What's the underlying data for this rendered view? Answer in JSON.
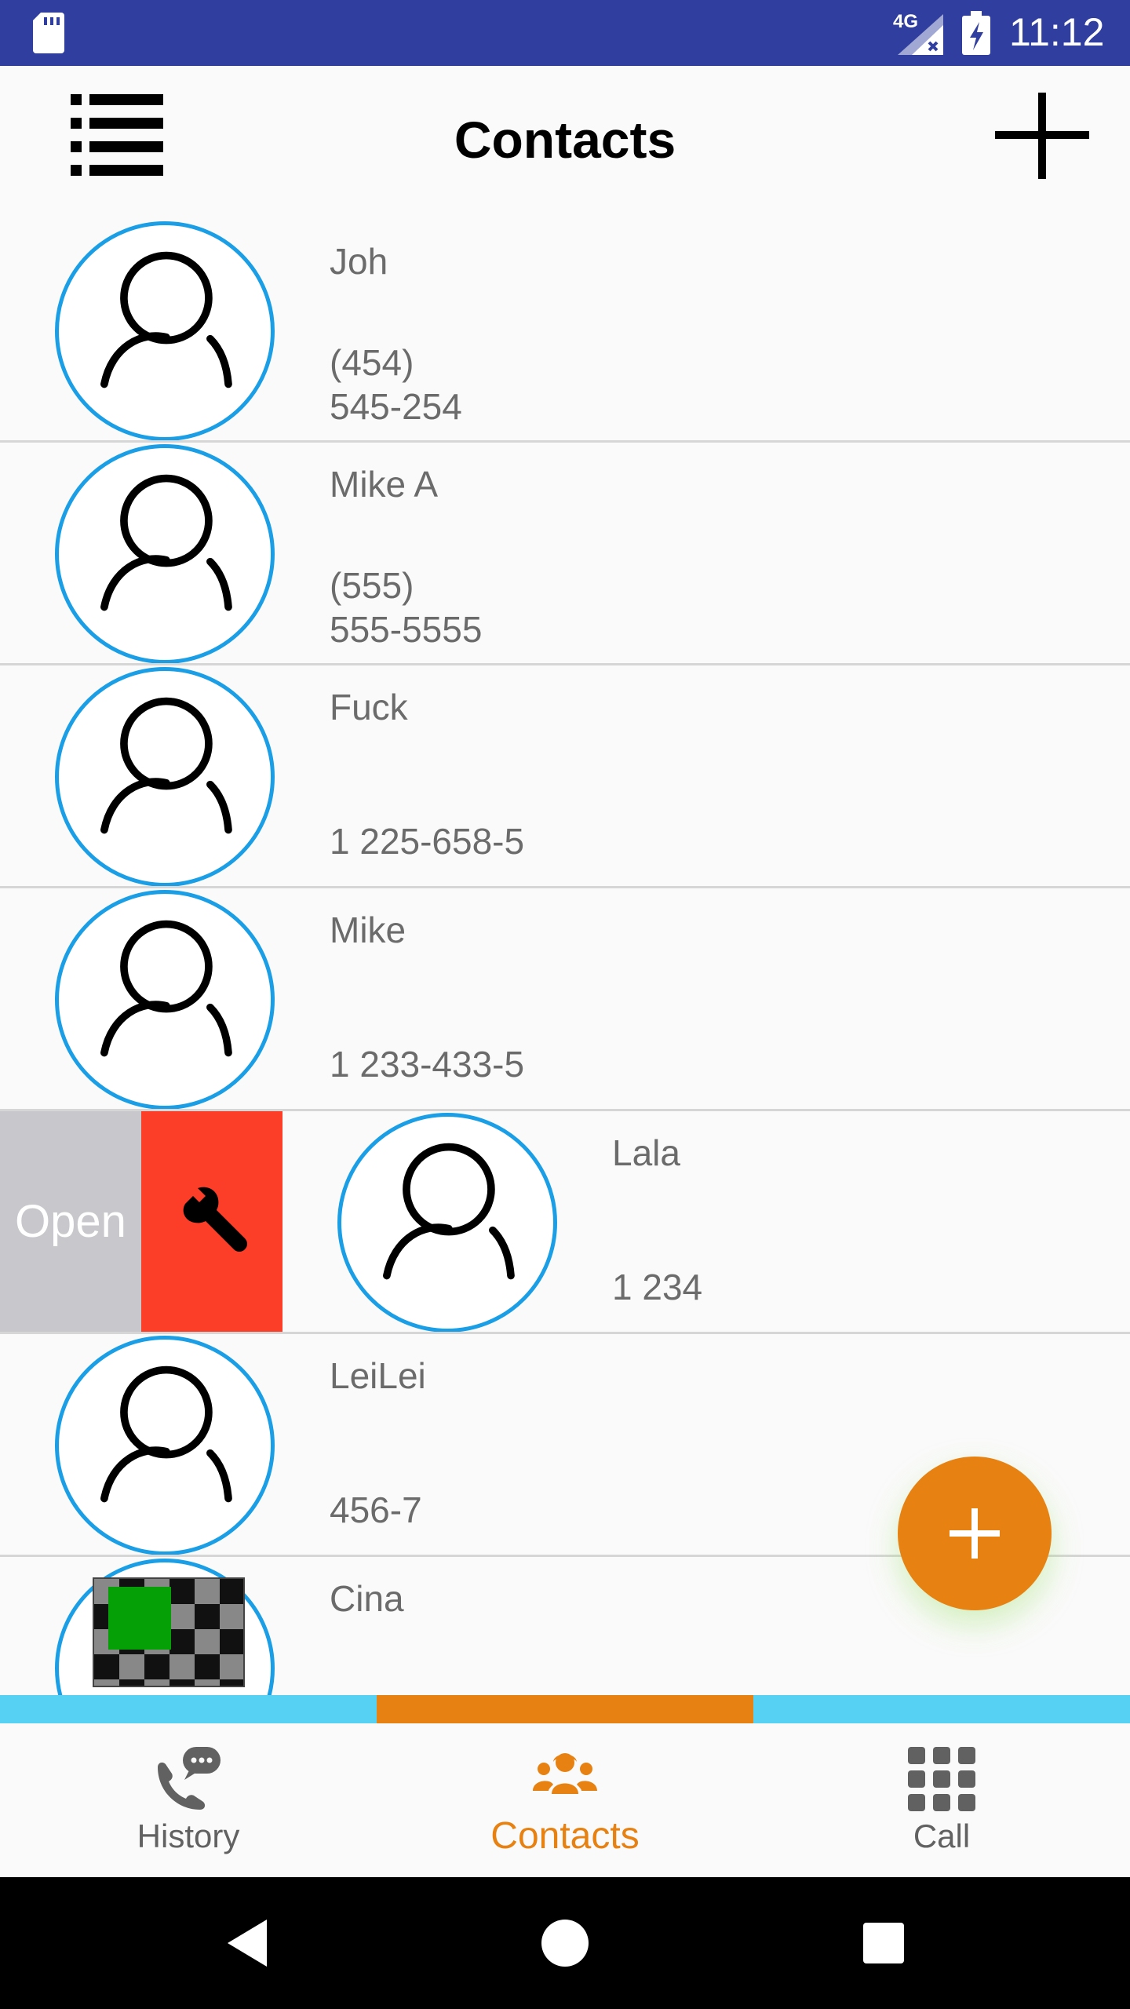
{
  "status_bar": {
    "network_label": "4G",
    "time": "11:12"
  },
  "app_bar": {
    "title": "Contacts",
    "menu_icon": "list-menu-icon",
    "add_icon": "plus-icon"
  },
  "contacts": [
    {
      "name": "Joh",
      "phone": "(454)\n545-254"
    },
    {
      "name": "Mike A",
      "phone": "(555)\n555-5555"
    },
    {
      "name": "Fuck",
      "phone": "1 225-658-5"
    },
    {
      "name": "Mike",
      "phone": "1 233-433-5"
    },
    {
      "name": "Lala",
      "phone": "1 234"
    },
    {
      "name": "LeiLei",
      "phone": "456-7"
    },
    {
      "name": "Cina",
      "phone": ""
    }
  ],
  "swipe_actions": {
    "open_label": "Open",
    "settings_icon": "wrench-icon"
  },
  "fab": {
    "icon": "plus-icon"
  },
  "tabs": [
    {
      "label": "History",
      "icon": "phone-chat-icon",
      "active": false
    },
    {
      "label": "Contacts",
      "icon": "group-icon",
      "active": true
    },
    {
      "label": "Call",
      "icon": "dialpad-icon",
      "active": false
    }
  ],
  "colors": {
    "status_bar": "#303f9f",
    "avatar_ring": "#1a9ee5",
    "accent": "#e78212",
    "tab_indicator_inactive": "#56d1f4",
    "swipe_open": "#c8c8cc",
    "swipe_wrench": "#fc3d27"
  },
  "system_nav": [
    "back-icon",
    "home-icon",
    "recents-icon"
  ]
}
